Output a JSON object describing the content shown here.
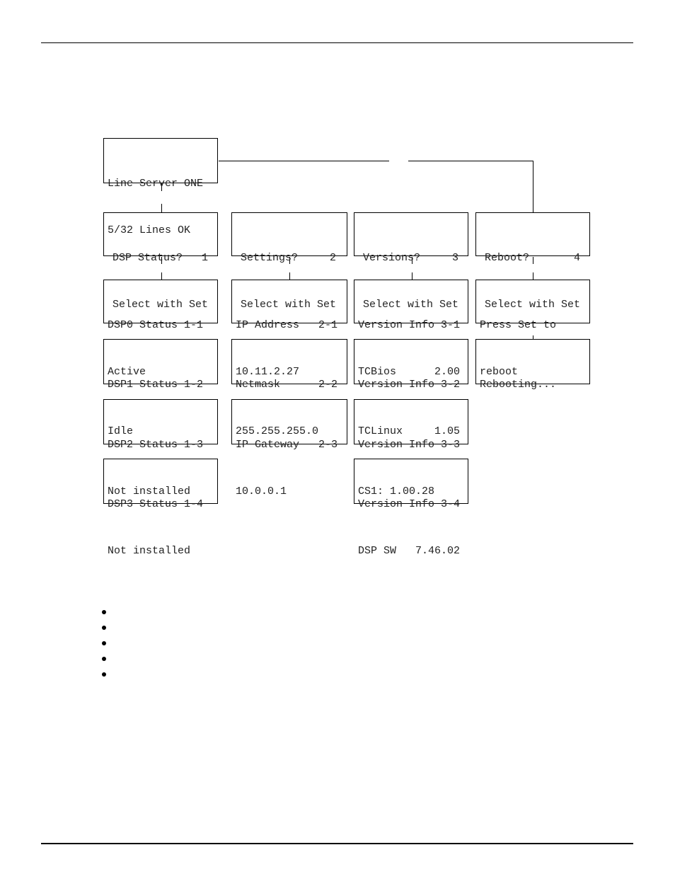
{
  "root": {
    "line1": "Line Server ONE",
    "line2": "5/32 Lines OK"
  },
  "menus": [
    {
      "line1": "DSP Status?   1",
      "line2": "Select with Set"
    },
    {
      "line1": "Settings?     2",
      "line2": "Select with Set"
    },
    {
      "line1": "Versions?     3",
      "line2": "Select with Set"
    },
    {
      "line1": "Reboot?       4",
      "line2": "Select with Set"
    }
  ],
  "dsp": [
    {
      "line1": "DSP0 Status 1-1",
      "line2": "Active"
    },
    {
      "line1": "DSP1 Status 1-2",
      "line2": "Idle"
    },
    {
      "line1": "DSP2 Status 1-3",
      "line2": "Not installed"
    },
    {
      "line1": "DSP3 Status 1-4",
      "line2": "Not installed"
    }
  ],
  "settings": [
    {
      "line1": "IP Address   2-1",
      "line2": "10.11.2.27"
    },
    {
      "line1": "Netmask      2-2",
      "line2": "255.255.255.0"
    },
    {
      "line1": "IP Gateway   2-3",
      "line2": "10.0.0.1"
    }
  ],
  "versions": [
    {
      "line1": "Version Info 3-1",
      "line2": "TCBios      2.00"
    },
    {
      "line1": "Version Info 3-2",
      "line2": "TCLinux     1.05"
    },
    {
      "line1": "Version Info 3-3",
      "line2": "CS1: 1.00.28"
    },
    {
      "line1": "Version Info 3-4",
      "line2": "DSP SW   7.46.02"
    }
  ],
  "reboot": [
    {
      "line1": "Press Set to",
      "line2": "reboot"
    },
    {
      "line1": "Rebooting...",
      "line2": ""
    }
  ],
  "bullets_count": 5
}
